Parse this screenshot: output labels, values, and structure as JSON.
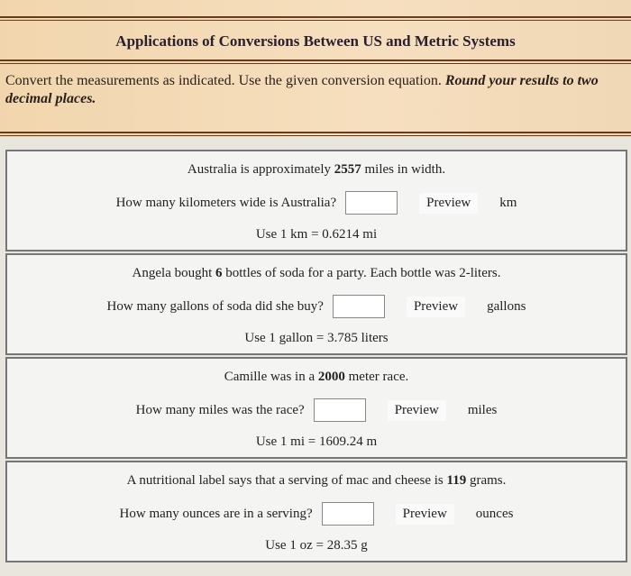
{
  "title": "Applications of Conversions Between US and Metric Systems",
  "instructions": {
    "text": "Convert the measurements as indicated. Use the given conversion equation.",
    "emphasis": "Round your results to two decimal places."
  },
  "problems": [
    {
      "stmt_a": "Australia is approximately ",
      "num": "2557",
      "stmt_b": " miles in width.",
      "question": "How many kilometers wide is Australia?",
      "answer": "",
      "preview": "Preview",
      "unit": "km",
      "hint": "Use 1 km = 0.6214 mi"
    },
    {
      "stmt_a": "Angela bought ",
      "num": "6",
      "stmt_b": " bottles of soda for a party. Each bottle was 2-liters.",
      "question": "How many gallons of soda did she buy?",
      "answer": "",
      "preview": "Preview",
      "unit": "gallons",
      "hint": "Use 1 gallon = 3.785 liters"
    },
    {
      "stmt_a": "Camille was in a ",
      "num": "2000",
      "stmt_b": " meter race.",
      "question": "How many miles was the race?",
      "answer": "",
      "preview": "Preview",
      "unit": "miles",
      "hint": "Use 1 mi = 1609.24 m"
    },
    {
      "stmt_a": "A nutritional label says that a serving of mac and cheese is ",
      "num": "119",
      "stmt_b": " grams.",
      "question": "How many ounces are in a serving?",
      "answer": "",
      "preview": "Preview",
      "unit": "ounces",
      "hint": "Use 1 oz = 28.35 g"
    }
  ]
}
